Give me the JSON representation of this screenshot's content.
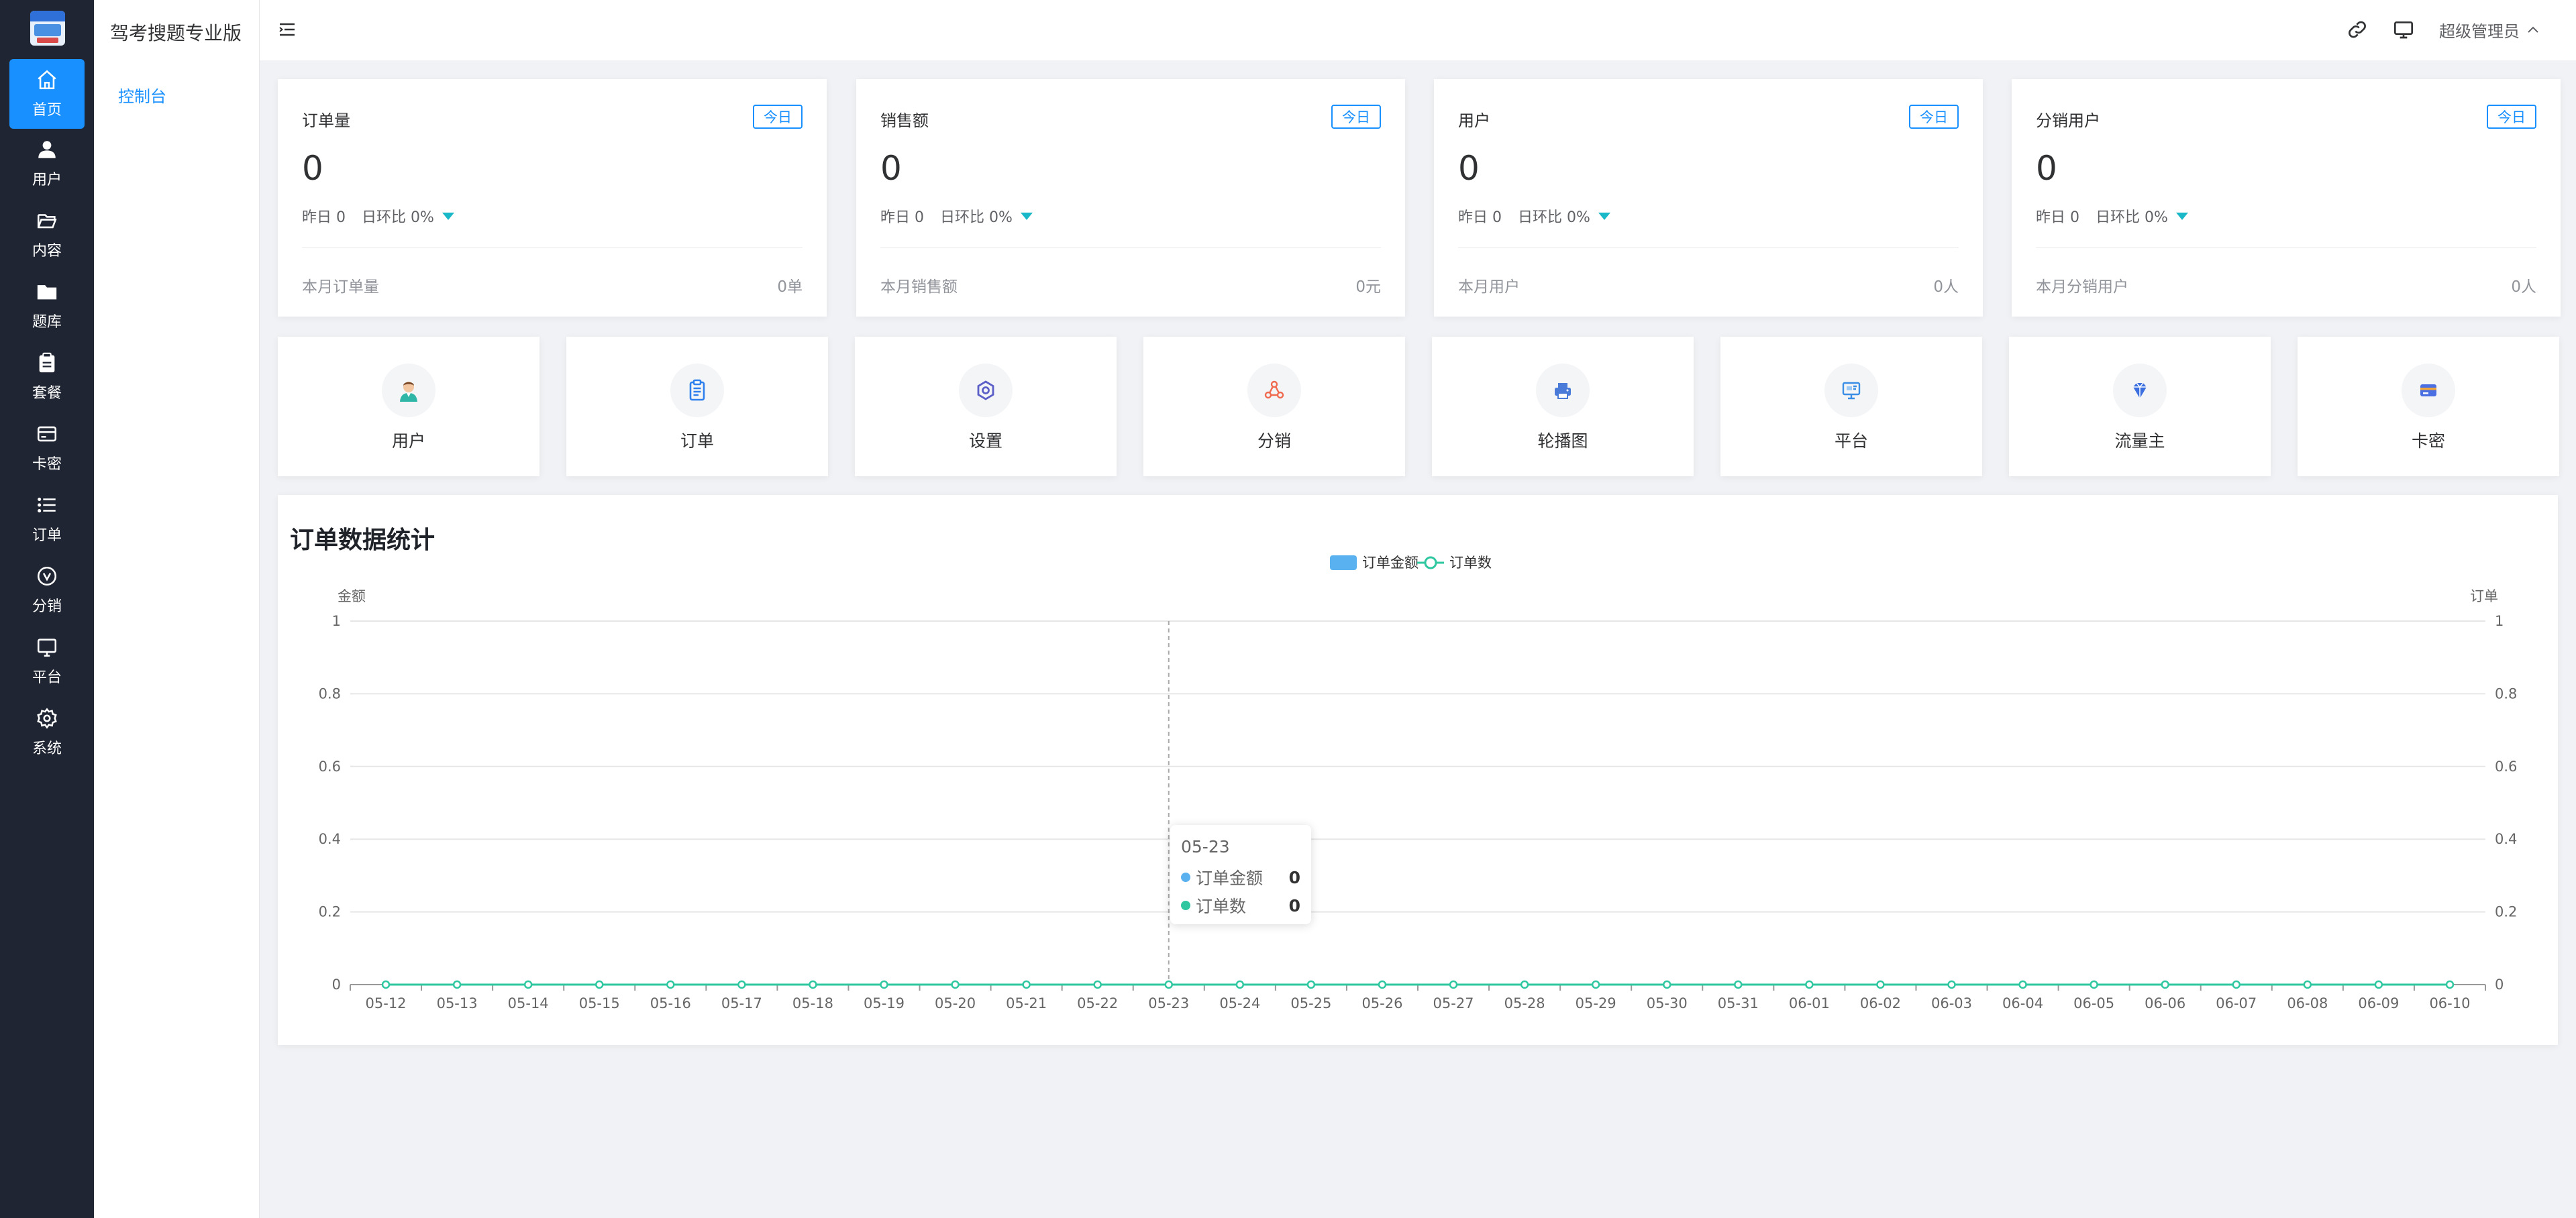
{
  "app": {
    "title": "驾考搜题专业版"
  },
  "rail": [
    {
      "label": "首页",
      "icon": "home-icon",
      "active": true
    },
    {
      "label": "用户",
      "icon": "user-icon"
    },
    {
      "label": "内容",
      "icon": "folder-open-icon"
    },
    {
      "label": "题库",
      "icon": "folder-icon"
    },
    {
      "label": "套餐",
      "icon": "clipboard-icon"
    },
    {
      "label": "卡密",
      "icon": "card-icon"
    },
    {
      "label": "订单",
      "icon": "list-icon"
    },
    {
      "label": "分销",
      "icon": "share-icon"
    },
    {
      "label": "平台",
      "icon": "monitor-icon"
    },
    {
      "label": "系统",
      "icon": "gear-icon"
    }
  ],
  "subnav": {
    "item": "控制台"
  },
  "header": {
    "user": "超级管理员"
  },
  "stats": [
    {
      "title": "订单量",
      "tag": "今日",
      "value": "0",
      "yesterday": "昨日 0",
      "ratio": "日环比 0%",
      "foot_label": "本月订单量",
      "foot_value": "0单"
    },
    {
      "title": "销售额",
      "tag": "今日",
      "value": "0",
      "yesterday": "昨日 0",
      "ratio": "日环比 0%",
      "foot_label": "本月销售额",
      "foot_value": "0元"
    },
    {
      "title": "用户",
      "tag": "今日",
      "value": "0",
      "yesterday": "昨日 0",
      "ratio": "日环比 0%",
      "foot_label": "本月用户",
      "foot_value": "0人"
    },
    {
      "title": "分销用户",
      "tag": "今日",
      "value": "0",
      "yesterday": "昨日 0",
      "ratio": "日环比 0%",
      "foot_label": "本月分销用户",
      "foot_value": "0人"
    }
  ],
  "shortcuts": [
    {
      "label": "用户",
      "icon": "user-avatar-icon"
    },
    {
      "label": "订单",
      "icon": "clipboard-icon"
    },
    {
      "label": "设置",
      "icon": "settings-icon"
    },
    {
      "label": "分销",
      "icon": "share-icon"
    },
    {
      "label": "轮播图",
      "icon": "printer-icon"
    },
    {
      "label": "平台",
      "icon": "monitor-icon"
    },
    {
      "label": "流量主",
      "icon": "diamond-icon"
    },
    {
      "label": "卡密",
      "icon": "card-icon"
    }
  ],
  "chart_title": "订单数据统计",
  "colors": {
    "accent": "#1890ff",
    "rail_bg": "#1f2532",
    "bar_series": "#5ab1ef",
    "line_series": "#2ec7a0"
  },
  "chart_data": {
    "type": "bar",
    "x": [
      "05-12",
      "05-13",
      "05-14",
      "05-15",
      "05-16",
      "05-17",
      "05-18",
      "05-19",
      "05-20",
      "05-21",
      "05-22",
      "05-23",
      "05-24",
      "05-25",
      "05-26",
      "05-27",
      "05-28",
      "05-29",
      "05-30",
      "05-31",
      "06-01",
      "06-02",
      "06-03",
      "06-04",
      "06-05",
      "06-06",
      "06-07",
      "06-08",
      "06-09",
      "06-10"
    ],
    "series": [
      {
        "name": "订单金额",
        "type": "bar",
        "axis": "left",
        "values": [
          0,
          0,
          0,
          0,
          0,
          0,
          0,
          0,
          0,
          0,
          0,
          0,
          0,
          0,
          0,
          0,
          0,
          0,
          0,
          0,
          0,
          0,
          0,
          0,
          0,
          0,
          0,
          0,
          0,
          0
        ]
      },
      {
        "name": "订单数",
        "type": "line",
        "axis": "right",
        "values": [
          0,
          0,
          0,
          0,
          0,
          0,
          0,
          0,
          0,
          0,
          0,
          0,
          0,
          0,
          0,
          0,
          0,
          0,
          0,
          0,
          0,
          0,
          0,
          0,
          0,
          0,
          0,
          0,
          0,
          0
        ]
      }
    ],
    "ylabel_left": "金额",
    "ylabel_right": "订单",
    "ylim": [
      0,
      1
    ],
    "y_ticks": [
      "0",
      "0.2",
      "0.4",
      "0.6",
      "0.8",
      "1"
    ],
    "grid": true,
    "legend": "top-center",
    "tooltip": {
      "date": "05-23",
      "rows": [
        {
          "name": "订单金额",
          "value": "0"
        },
        {
          "name": "订单数",
          "value": "0"
        }
      ]
    }
  }
}
